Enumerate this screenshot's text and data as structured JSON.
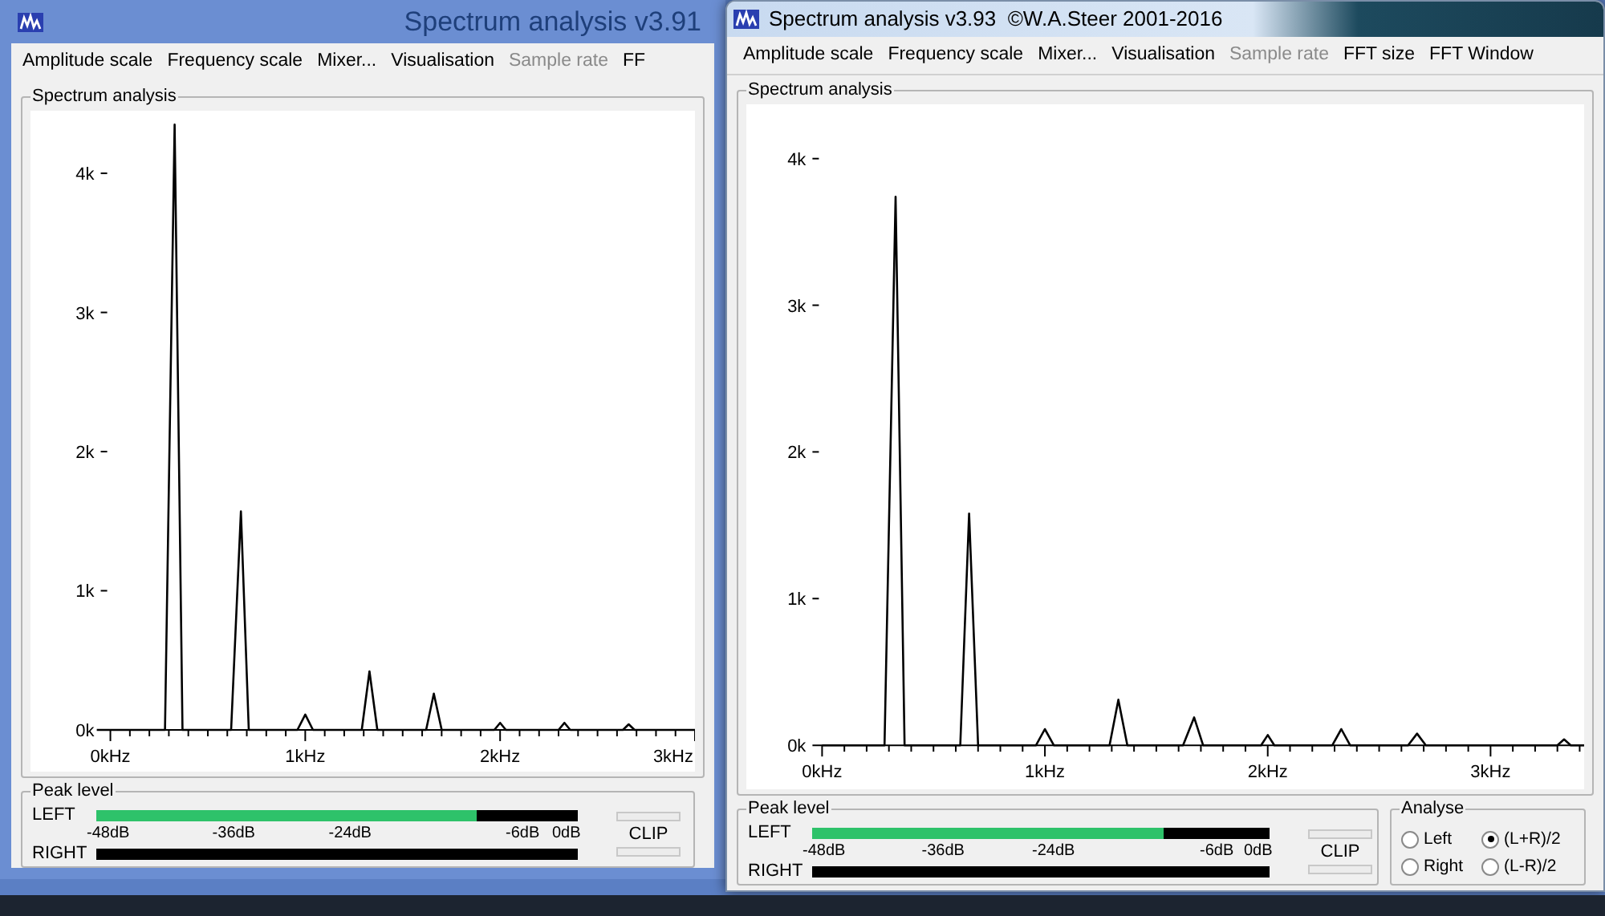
{
  "windows": [
    {
      "title": "Spectrum analysis v3.91",
      "active": false,
      "menu": [
        {
          "label": "Amplitude scale",
          "disabled": false
        },
        {
          "label": "Frequency scale",
          "disabled": false
        },
        {
          "label": "Mixer...",
          "disabled": false
        },
        {
          "label": "Visualisation",
          "disabled": false
        },
        {
          "label": "Sample rate",
          "disabled": true
        },
        {
          "label": "FF",
          "disabled": false
        }
      ],
      "spectrum": {
        "title": "Spectrum analysis",
        "chart_data": {
          "type": "line",
          "x": [
            -0.07,
            0.28,
            0.33,
            0.37,
            0.62,
            0.67,
            0.71,
            0.96,
            1.0,
            1.04,
            1.29,
            1.33,
            1.37,
            1.62,
            1.66,
            1.7,
            1.97,
            2.0,
            2.03,
            2.3,
            2.33,
            2.36,
            2.63,
            2.66,
            2.69,
            3.0
          ],
          "series": [
            {
              "color": "#000000",
              "values": [
                0,
                0,
                4.35,
                0,
                0,
                1.57,
                0,
                0,
                0.11,
                0,
                0,
                0.42,
                0,
                0,
                0.26,
                0,
                0,
                0.05,
                0,
                0,
                0.05,
                0,
                0,
                0.04,
                0,
                0
              ]
            }
          ],
          "xlim": [
            -0.41,
            3.0
          ],
          "ylim": [
            -0.3,
            4.45
          ],
          "xticks": [
            {
              "value": 0,
              "label": "0kHz"
            },
            {
              "value": 1,
              "label": "1kHz"
            },
            {
              "value": 2,
              "label": "2kHz"
            },
            {
              "value": 3,
              "label": "3kHz"
            }
          ],
          "yticks": [
            {
              "value": 0,
              "label": "0k"
            },
            {
              "value": 1,
              "label": "1k"
            },
            {
              "value": 2,
              "label": "2k"
            },
            {
              "value": 3,
              "label": "3k"
            },
            {
              "value": 4,
              "label": "4k"
            }
          ]
        }
      },
      "peak": {
        "title": "Peak level",
        "channels": [
          {
            "label": "LEFT",
            "level": 0.79
          },
          {
            "label": "RIGHT"
          }
        ],
        "scale": [
          "-48dB",
          "-36dB",
          "-24dB",
          "-6dB",
          "0dB"
        ],
        "clip": "CLIP"
      }
    },
    {
      "title": "Spectrum analysis v3.93  ©W.A.Steer 2001-2016",
      "active": true,
      "menu": [
        {
          "label": "Amplitude scale",
          "disabled": false
        },
        {
          "label": "Frequency scale",
          "disabled": false
        },
        {
          "label": "Mixer...",
          "disabled": false
        },
        {
          "label": "Visualisation",
          "disabled": false
        },
        {
          "label": "Sample rate",
          "disabled": true
        },
        {
          "label": "FFT size",
          "disabled": false
        },
        {
          "label": "FFT Window",
          "disabled": false
        }
      ],
      "spectrum": {
        "title": "Spectrum analysis",
        "chart_data": {
          "type": "line",
          "x": [
            0,
            0.28,
            0.33,
            0.37,
            0.62,
            0.66,
            0.7,
            0.96,
            1.0,
            1.04,
            1.29,
            1.33,
            1.37,
            1.62,
            1.67,
            1.71,
            1.97,
            2.0,
            2.03,
            2.29,
            2.33,
            2.37,
            2.63,
            2.67,
            2.71,
            3.3,
            3.33,
            3.36,
            3.42
          ],
          "series": [
            {
              "color": "#000000",
              "values": [
                0,
                0,
                3.74,
                0,
                0,
                1.58,
                0,
                0,
                0.11,
                0,
                0,
                0.31,
                0,
                0,
                0.19,
                0,
                0,
                0.07,
                0,
                0,
                0.11,
                0,
                0,
                0.08,
                0,
                0,
                0.04,
                0,
                0
              ]
            }
          ],
          "xlim": [
            -0.34,
            3.42
          ],
          "ylim": [
            -0.3,
            4.37
          ],
          "xticks": [
            {
              "value": 0,
              "label": "0kHz"
            },
            {
              "value": 1,
              "label": "1kHz"
            },
            {
              "value": 2,
              "label": "2kHz"
            },
            {
              "value": 3,
              "label": "3kHz"
            }
          ],
          "yticks": [
            {
              "value": 0,
              "label": "0k"
            },
            {
              "value": 1,
              "label": "1k"
            },
            {
              "value": 2,
              "label": "2k"
            },
            {
              "value": 3,
              "label": "3k"
            },
            {
              "value": 4,
              "label": "4k"
            }
          ]
        }
      },
      "peak": {
        "title": "Peak level",
        "channels": [
          {
            "label": "LEFT",
            "level": 0.77
          },
          {
            "label": "RIGHT"
          }
        ],
        "scale": [
          "-48dB",
          "-36dB",
          "-24dB",
          "-6dB",
          "0dB"
        ],
        "clip": "CLIP"
      },
      "analyse": {
        "title": "Analyse",
        "options": [
          {
            "label": "Left",
            "selected": false
          },
          {
            "label": "(L+R)/2",
            "selected": true
          },
          {
            "label": "Right",
            "selected": false
          },
          {
            "label": "(L-R)/2",
            "selected": false
          }
        ]
      }
    }
  ]
}
